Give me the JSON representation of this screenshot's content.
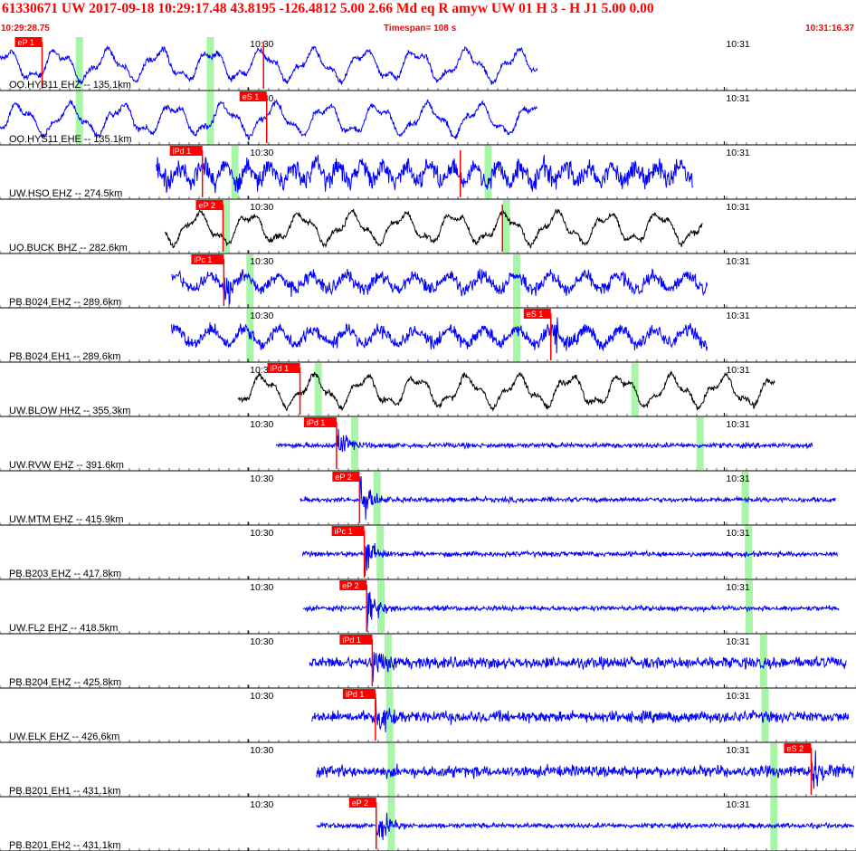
{
  "header": {
    "event_line": "61330671 UW 2017-09-18 10:29:17.48   43.8195 -126.4812   5.00  2.66 Md   eq   R amyw     UW 01  H   3  -  H J1    5.00  0.00",
    "start_time": "10:29:28.75",
    "timespan": "Timespan= 108 s",
    "end_time": "10:31:16.37"
  },
  "colors": {
    "trace_vertical": "#0000ff",
    "trace_broadband": "#000000",
    "pick_box": "#ff0000",
    "pick_text": "#ffffff",
    "header_text": "#ff0000",
    "green_marker": "#a8f5a8",
    "frame": "#000000",
    "label_text": "#000000"
  },
  "chart_data": {
    "type": "line",
    "title": "",
    "x_unit": "seconds from 10:29:28.75",
    "xlim": [
      0,
      107.62
    ],
    "minute_marks": [
      {
        "label": "10:30",
        "t": 31.25
      },
      {
        "label": "10:31",
        "t": 91.25
      }
    ],
    "traces": [
      {
        "name": "OO.HYB11 EHZ -- 135.1km",
        "color": "blue",
        "t_start": 0.0,
        "t_end": 67.7,
        "style": "long",
        "picks": [
          {
            "label": "eP 1",
            "t": 5.3
          },
          {
            "label": "",
            "t": 33.2
          }
        ],
        "green": [
          10.0,
          26.5
        ]
      },
      {
        "name": "OO.HYS11 EHE -- 135.1km",
        "color": "blue",
        "t_start": 0.0,
        "t_end": 67.7,
        "style": "long",
        "picks": [
          {
            "label": "eS 1",
            "t": 33.6
          }
        ],
        "green": [
          10.0,
          26.5
        ]
      },
      {
        "name": "UW.HSO EHZ -- 274.5km",
        "color": "blue",
        "t_start": 19.7,
        "t_end": 87.3,
        "style": "dense",
        "picks": [
          {
            "label": "iPd 1",
            "t": 25.5
          },
          {
            "label": "",
            "t": 58.0
          }
        ],
        "green": [
          29.6,
          61.5
        ]
      },
      {
        "name": "UO.BUCK BHZ -- 282.6km",
        "color": "black",
        "t_start": 20.8,
        "t_end": 88.5,
        "style": "long",
        "picks": [
          {
            "label": "eP 2",
            "t": 28.1
          },
          {
            "label": "",
            "t": 63.3
          }
        ],
        "green": [
          28.5,
          63.8
        ]
      },
      {
        "name": "PB.B024 EHZ -- 289.6km",
        "color": "blue",
        "t_start": 21.6,
        "t_end": 89.1,
        "style": "noise",
        "picks": [
          {
            "label": "iPc 1",
            "t": 28.2
          }
        ],
        "green": [
          31.5,
          65.1
        ]
      },
      {
        "name": "PB.B024 EH1 -- 289.6km",
        "color": "blue",
        "t_start": 21.6,
        "t_end": 89.1,
        "style": "noise",
        "picks": [
          {
            "label": "eS 1",
            "t": 69.4
          }
        ],
        "green": [
          31.5,
          65.1
        ]
      },
      {
        "name": "UW.BLOW HHZ -- 355.3km",
        "color": "black",
        "t_start": 30.0,
        "t_end": 97.6,
        "style": "long",
        "picks": [
          {
            "label": "iPd 1",
            "t": 37.8
          }
        ],
        "green": [
          40.1,
          80.0
        ]
      },
      {
        "name": "UW.RVW EHZ -- 391.6km",
        "color": "blue",
        "t_start": 34.8,
        "t_end": 102.4,
        "style": "quiet",
        "picks": [
          {
            "label": "iPd 1",
            "t": 42.4
          }
        ],
        "green": [
          44.7,
          88.2
        ]
      },
      {
        "name": "UW.MTM EHZ -- 415.9km",
        "color": "blue",
        "t_start": 37.8,
        "t_end": 105.3,
        "style": "quiet",
        "picks": [
          {
            "label": "eP 2",
            "t": 45.3
          }
        ],
        "green": [
          47.5,
          93.9
        ]
      },
      {
        "name": "PB.B203 EHZ -- 417.8km",
        "color": "blue",
        "t_start": 38.1,
        "t_end": 105.5,
        "style": "quiet",
        "picks": [
          {
            "label": "iPc 1",
            "t": 45.9
          }
        ],
        "green": [
          47.9,
          94.3
        ]
      },
      {
        "name": "UW.FL2 EHZ -- 418.5km",
        "color": "blue",
        "t_start": 38.2,
        "t_end": 105.7,
        "style": "quiet",
        "picks": [
          {
            "label": "eP 2",
            "t": 46.2
          }
        ],
        "green": [
          48.0,
          94.4
        ]
      },
      {
        "name": "PB.B204 EHZ -- 425.8km",
        "color": "blue",
        "t_start": 39.0,
        "t_end": 106.6,
        "style": "active",
        "picks": [
          {
            "label": "iPd 1",
            "t": 46.9
          }
        ],
        "green": [
          48.9,
          96.2
        ]
      },
      {
        "name": "UW.ELK EHZ -- 426.6km",
        "color": "blue",
        "t_start": 39.3,
        "t_end": 106.9,
        "style": "active",
        "picks": [
          {
            "label": "iPd 1",
            "t": 47.3
          }
        ],
        "green": [
          49.1,
          96.4
        ]
      },
      {
        "name": "PB.B201 EH1 -- 431.1km",
        "color": "blue",
        "t_start": 39.9,
        "t_end": 107.6,
        "style": "active",
        "picks": [
          {
            "label": "eS 2",
            "t": 102.2
          }
        ],
        "green": [
          49.3,
          97.5
        ]
      },
      {
        "name": "PB.B201 EH2 -- 431.1km",
        "color": "blue",
        "t_start": 39.9,
        "t_end": 107.6,
        "style": "quiet",
        "picks": [
          {
            "label": "eP 2",
            "t": 47.4
          }
        ],
        "green": [
          49.3,
          97.5
        ]
      }
    ]
  }
}
